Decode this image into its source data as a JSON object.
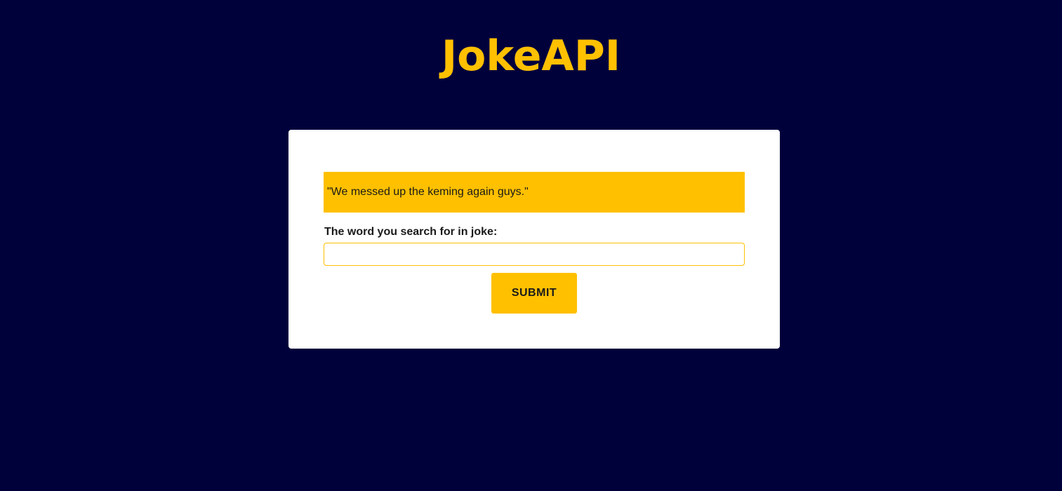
{
  "header": {
    "title": "JokeAPI"
  },
  "card": {
    "joke_text": "\"We messed up the keming again guys.\"",
    "search_label": "The word you search for in joke:",
    "search_value": "",
    "submit_label": "SUBMIT"
  },
  "colors": {
    "background": "#00003b",
    "accent": "#ffc000",
    "card": "#ffffff",
    "text": "#1a1a1a"
  }
}
